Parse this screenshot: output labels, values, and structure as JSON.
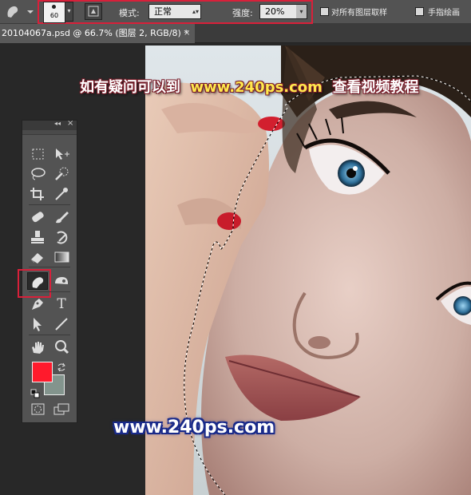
{
  "options_bar": {
    "brush_size": "60",
    "mode_label": "模式:",
    "mode_value": "正常",
    "strength_label": "强度:",
    "strength_value": "20%",
    "option_sample_all": "对所有图层取样",
    "option_finger": "手指绘画"
  },
  "document_tab": {
    "title": "20104067a.psd @ 66.7% (图层 2, RGB/8) *",
    "close": "×"
  },
  "toolbox": {
    "collapse": "◂◂",
    "close": "×",
    "tools": [
      {
        "name": "marquee-tool-icon"
      },
      {
        "name": "move-tool-icon"
      },
      {
        "name": "lasso-tool-icon"
      },
      {
        "name": "quick-selection-tool-icon"
      },
      {
        "name": "crop-tool-icon"
      },
      {
        "name": "eyedropper-tool-icon"
      },
      {
        "name": "healing-brush-tool-icon"
      },
      {
        "name": "brush-tool-icon"
      },
      {
        "name": "clone-stamp-tool-icon"
      },
      {
        "name": "history-brush-tool-icon"
      },
      {
        "name": "eraser-tool-icon"
      },
      {
        "name": "gradient-tool-icon"
      },
      {
        "name": "smudge-tool-icon",
        "active": true
      },
      {
        "name": "dodge-tool-icon"
      },
      {
        "name": "pen-tool-icon"
      },
      {
        "name": "type-tool-icon"
      },
      {
        "name": "path-selection-tool-icon"
      },
      {
        "name": "line-tool-icon"
      },
      {
        "name": "hand-tool-icon"
      },
      {
        "name": "zoom-tool-icon"
      },
      {
        "name": "quick-mask-icon"
      },
      {
        "name": "screen-mode-icon"
      }
    ],
    "type_glyph": "T",
    "foreground_color": "#ff1a2c",
    "background_color": "#83948d"
  },
  "overlay": {
    "prefix": "如有疑问可以到",
    "url": "www.240ps.com",
    "suffix": "查看视频教程",
    "watermark": "www.240ps.com"
  },
  "highlight_color": "#d8203a"
}
